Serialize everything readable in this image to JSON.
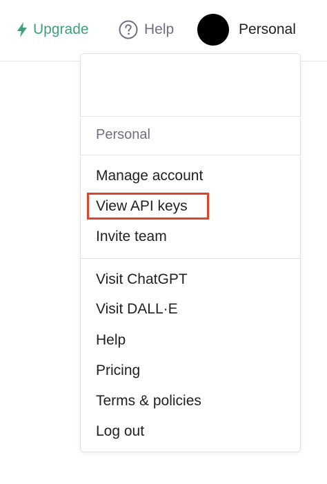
{
  "topbar": {
    "upgrade": {
      "label": "Upgrade",
      "icon": "lightning-icon"
    },
    "help": {
      "label": "Help",
      "icon": "question-circle-icon"
    },
    "account": {
      "label": "Personal"
    }
  },
  "menu": {
    "section_label": "Personal",
    "account_items": [
      {
        "label": "Manage account"
      },
      {
        "label": "View API keys"
      },
      {
        "label": "Invite team"
      }
    ],
    "link_items": [
      {
        "label": "Visit ChatGPT"
      },
      {
        "label": "Visit DALL·E"
      },
      {
        "label": "Help"
      },
      {
        "label": "Pricing"
      },
      {
        "label": "Terms & policies"
      },
      {
        "label": "Log out"
      }
    ]
  },
  "colors": {
    "upgrade_accent": "#3fa07a",
    "highlight": "#e0422b",
    "muted_text": "#6e6e80"
  }
}
